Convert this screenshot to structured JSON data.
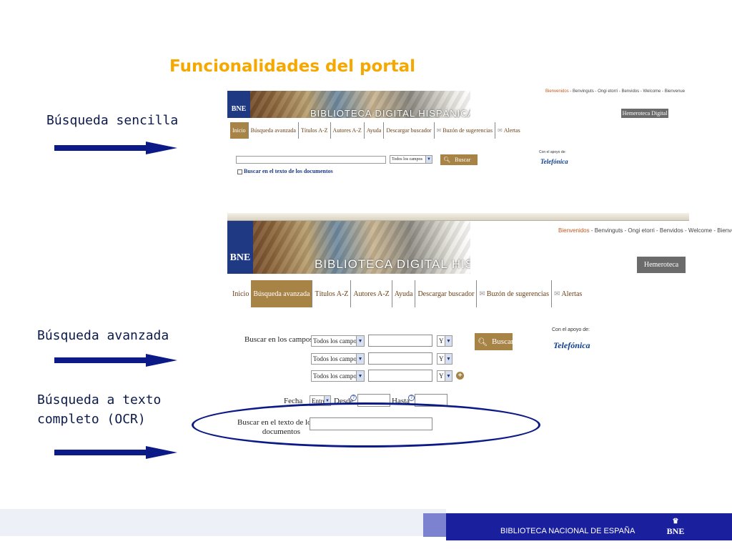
{
  "slide": {
    "title": "Funcionalidades del portal",
    "labels": {
      "simple": "Búsqueda sencilla",
      "advanced": "Búsqueda avanzada",
      "ocr_line1": "Búsqueda a texto",
      "ocr_line2": "completo (OCR)"
    }
  },
  "portal": {
    "logo": "BNE",
    "logo_subtitle": "BIBLIOTECA NACIONAL DE ESPAÑA",
    "banner_title": "BIBLIOTECA DIGITAL HISPÁNICA",
    "languages": [
      "Bienvenidos",
      "Benvinguts",
      "Ongi etorri",
      "Benvidos",
      "Welcome",
      "Bienvenue"
    ],
    "languages_separator": " - ",
    "hemeroteca_button": "Hemeroteca Digital",
    "tabs": [
      "Inicio",
      "Búsqueda avanzada",
      "Títulos A-Z",
      "Autores A-Z",
      "Ayuda",
      "Descargar buscador",
      "Buzón de sugerencias",
      "Alertas"
    ],
    "sponsor_text": "Con el apoyo de:",
    "sponsor_brand": "Telefónica",
    "search_button": "Buscar"
  },
  "simple_search": {
    "field_select": "Todos los campos",
    "checkbox_label": "Buscar en el texto de los documentos"
  },
  "advanced_search": {
    "fields_label": "Buscar en los campos",
    "rows": [
      {
        "field": "Todos los campos",
        "operator": "Y"
      },
      {
        "field": "Todos los campos",
        "operator": "Y"
      },
      {
        "field": "Todos los campos",
        "operator": "Y"
      }
    ],
    "date_label": "Fecha",
    "date_mode": "Entre",
    "from_label": "Desde",
    "to_label": "Hasta",
    "fulltext_label_line1": "Buscar en el texto de los",
    "fulltext_label_line2": "documentos"
  },
  "footer": {
    "text": "BIBLIOTECA NACIONAL DE ESPAÑA",
    "logo": "BNE"
  },
  "colors": {
    "title": "#f5a800",
    "label": "#0b1a4a",
    "arrow": "#0b1a86",
    "bne_blue": "#1f3a82",
    "tab_active": "#a88346",
    "footer_bar": "#1a1f9e"
  }
}
